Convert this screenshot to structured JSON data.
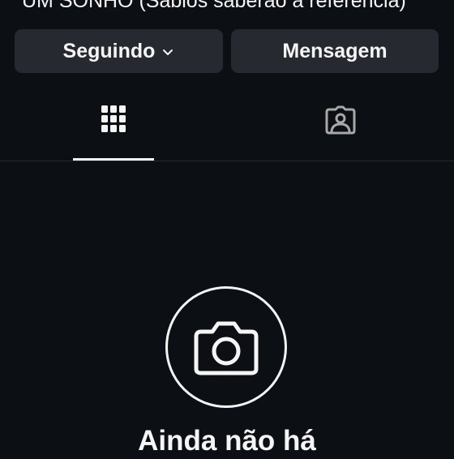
{
  "profile": {
    "bio_line": "UM SONHO (Sábios saberão a referência)"
  },
  "actions": {
    "following_label": "Seguindo",
    "message_label": "Mensagem"
  },
  "tabs": [
    {
      "name": "posts",
      "icon": "grid-icon",
      "selected": true
    },
    {
      "name": "tagged",
      "icon": "tagged-person-icon",
      "selected": false
    }
  ],
  "empty_state": {
    "icon": "camera-icon",
    "title": "Ainda não há"
  },
  "colors": {
    "background": "#0c1014",
    "button_bg": "#262a30",
    "text": "#f5f5f5",
    "muted_icon": "#a8a8a8"
  }
}
